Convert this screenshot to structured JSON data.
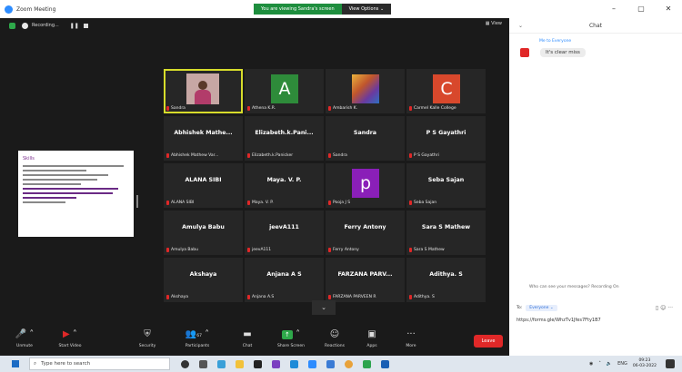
{
  "window": {
    "title": "Zoom Meeting",
    "minimize": "–",
    "maximize": "▢",
    "close": "✕"
  },
  "banner": {
    "text": "You are viewing Sandra's screen",
    "view_options": "View Options ⌄"
  },
  "topbar": {
    "recording_label": "Recording...",
    "view_label": "View"
  },
  "shared_slide": {
    "heading": "Skills"
  },
  "tiles": [
    {
      "name": "",
      "label": "Sandra",
      "kind": "camera"
    },
    {
      "name": "",
      "label": "Athena K.R.",
      "kind": "letter",
      "letter": "A",
      "color": "#2e8b3a"
    },
    {
      "name": "",
      "label": "Ambarish K.",
      "kind": "lion"
    },
    {
      "name": "",
      "label": "Carmel Kalle College",
      "kind": "letter",
      "letter": "C",
      "color": "#d8482c"
    },
    {
      "name": "Abhishek Mathe...",
      "label": "Abhishek Mathew Var...",
      "kind": "name"
    },
    {
      "name": "Elizabeth.k.Pani...",
      "label": "Elizabeth.k.Panicker",
      "kind": "name"
    },
    {
      "name": "Sandra",
      "label": "Sandra",
      "kind": "name"
    },
    {
      "name": "P S Gayathri",
      "label": "P S Gayathri",
      "kind": "name"
    },
    {
      "name": "ALANA SIBI",
      "label": "ALANA SIBI",
      "kind": "name"
    },
    {
      "name": "Maya. V. P.",
      "label": "Maya. V. P.",
      "kind": "name"
    },
    {
      "name": "",
      "label": "Pooja J S",
      "kind": "letter",
      "letter": "p",
      "color": "#8a1fb8"
    },
    {
      "name": "Seba Sajan",
      "label": "Seba Sajan",
      "kind": "name"
    },
    {
      "name": "Amulya Babu",
      "label": "Amulya Babu",
      "kind": "name"
    },
    {
      "name": "jeevA111",
      "label": "jeevA111",
      "kind": "name"
    },
    {
      "name": "Ferry Antony",
      "label": "Ferry Antony",
      "kind": "name"
    },
    {
      "name": "Sara S Mathew",
      "label": "Sara S Mathew",
      "kind": "name"
    },
    {
      "name": "Akshaya",
      "label": "Akshaya",
      "kind": "name"
    },
    {
      "name": "Anjana A S",
      "label": "Anjana A.S",
      "kind": "name"
    },
    {
      "name": "FARZANA PARV...",
      "label": "FARZANA PARVEEN R",
      "kind": "name"
    },
    {
      "name": "Adithya. S",
      "label": "Adithya. S",
      "kind": "name"
    }
  ],
  "toolbar": {
    "unmute": "Unmute",
    "start_video": "Start Video",
    "security": "Security",
    "participants": "Participants",
    "participants_count": "67",
    "chat": "Chat",
    "share_screen": "Share Screen",
    "reactions": "Reactions",
    "apps": "Apps",
    "more": "More",
    "leave": "Leave"
  },
  "chat": {
    "title": "Chat",
    "from": "Me to Everyone",
    "message": "It's clear miss",
    "note": "Who can see your messages? Recording On",
    "to_label": "To:",
    "to_value": "Everyone ⌄",
    "draft": "https://forms.gle/WhzTv1Jfes7Fty1B7"
  },
  "taskbar": {
    "search_placeholder": "Type here to search",
    "time": "09:23",
    "date": "06-03-2022",
    "lang": "ENG"
  }
}
